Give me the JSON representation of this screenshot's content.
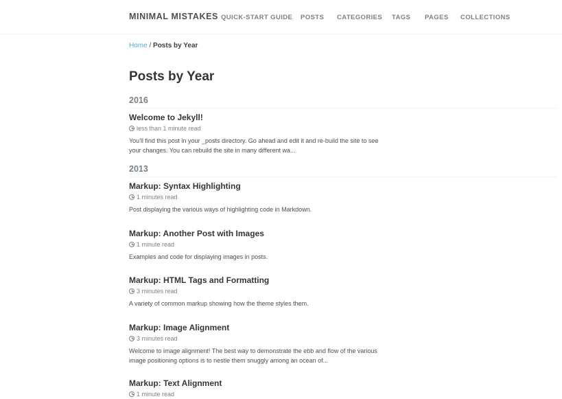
{
  "masthead": {
    "site_title": "MINIMAL MISTAKES",
    "nav": [
      {
        "label": "QUICK-START GUIDE"
      },
      {
        "label": "POSTS"
      },
      {
        "label": "CATEGORIES"
      },
      {
        "label": "TAGS"
      },
      {
        "label": "PAGES"
      },
      {
        "label": "COLLECTIONS"
      }
    ]
  },
  "breadcrumb": {
    "home_label": "Home",
    "separator": " / ",
    "current": "Posts by Year"
  },
  "page_title": "Posts by Year",
  "years": [
    {
      "year": "2016",
      "posts": [
        {
          "title": "Welcome to Jekyll!",
          "read_time": "less than 1 minute read",
          "excerpt": "You'll find this post in your _posts directory. Go ahead and edit it and re-build the site to see your changes. You can rebuild the site in many different wa..."
        }
      ]
    },
    {
      "year": "2013",
      "posts": [
        {
          "title": "Markup: Syntax Highlighting",
          "read_time": "1 minutes read",
          "excerpt": "Post displaying the various ways of highlighting code in Markdown."
        },
        {
          "title": "Markup: Another Post with Images",
          "read_time": "1 minute read",
          "excerpt": "Examples and code for displaying images in posts."
        },
        {
          "title": "Markup: HTML Tags and Formatting",
          "read_time": "3 minutes read",
          "excerpt": "A variety of common markup showing how the theme styles them."
        },
        {
          "title": "Markup: Image Alignment",
          "read_time": "3 minutes read",
          "excerpt": "Welcome to image alignment! The best way to demonstrate the ebb and flow of the various image positioning options is to nestle them snuggly among an ocean of..."
        },
        {
          "title": "Markup: Text Alignment",
          "read_time": "1 minute read",
          "excerpt": ""
        }
      ]
    }
  ],
  "icons": {
    "read_time": "clock-icon"
  },
  "colors": {
    "link": "#52adc8",
    "text": "#494e52",
    "muted": "#7a8288",
    "heading": "#313639"
  }
}
